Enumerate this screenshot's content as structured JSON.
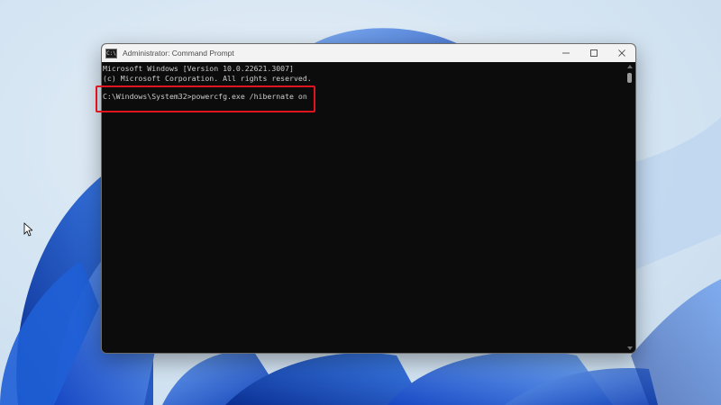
{
  "window": {
    "title": "Administrator: Command Prompt",
    "icon": "cmd-icon"
  },
  "console": {
    "line1": "Microsoft Windows [Version 10.0.22621.3007]",
    "line2": "(c) Microsoft Corporation. All rights reserved.",
    "prompt": "C:\\Windows\\System32>",
    "command": "powercfg.exe /hibernate on"
  },
  "colors": {
    "console_bg": "#0c0c0c",
    "console_text": "#cccccc",
    "highlight": "#e0141e",
    "wallpaper_blue": "#1f5fd6"
  }
}
